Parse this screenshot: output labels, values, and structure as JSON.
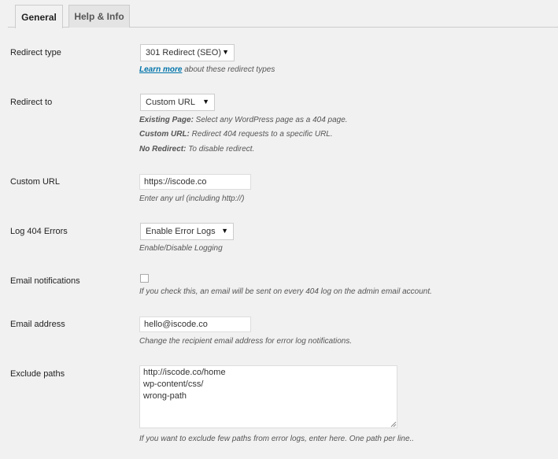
{
  "tabs": [
    {
      "label": "General",
      "active": true
    },
    {
      "label": "Help & Info",
      "active": false
    }
  ],
  "fields": {
    "redirect_type": {
      "label": "Redirect type",
      "selected": "301 Redirect (SEO)",
      "learn_more": "Learn more",
      "desc_rest": " about these redirect types"
    },
    "redirect_to": {
      "label": "Redirect to",
      "selected": "Custom URL",
      "help": [
        {
          "term": "Existing Page:",
          "text": " Select any WordPress page as a 404 page."
        },
        {
          "term": "Custom URL:",
          "text": " Redirect 404 requests to a specific URL."
        },
        {
          "term": "No Redirect:",
          "text": " To disable redirect."
        }
      ]
    },
    "custom_url": {
      "label": "Custom URL",
      "value": "https://iscode.co",
      "desc": "Enter any url (including http://)"
    },
    "log_errors": {
      "label": "Log 404 Errors",
      "selected": "Enable Error Logs",
      "desc": "Enable/Disable Logging"
    },
    "email_notifications": {
      "label": "Email notifications",
      "checked": false,
      "desc": "If you check this, an email will be sent on every 404 log on the admin email account."
    },
    "email_address": {
      "label": "Email address",
      "value": "hello@iscode.co",
      "desc": "Change the recipient email address for error log notifications."
    },
    "exclude_paths": {
      "label": "Exclude paths",
      "value": "http://iscode.co/home\nwp-content/css/\nwrong-path",
      "desc": "If you want to exclude few paths from error logs, enter here. One path per line.."
    }
  },
  "colors": {
    "background": "#f1f1f1",
    "link": "#0073aa",
    "border": "#cccccc"
  }
}
